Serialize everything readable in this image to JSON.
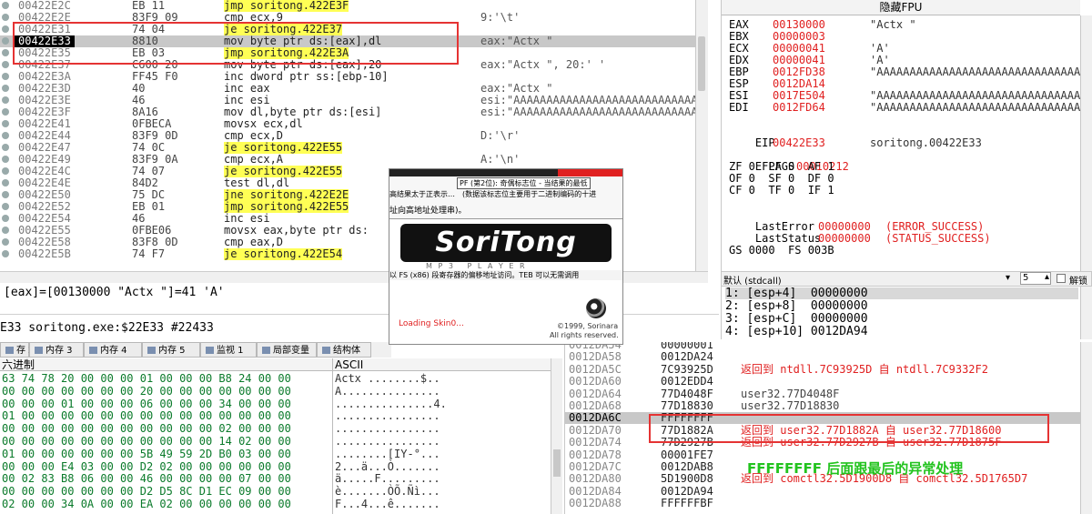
{
  "disasm": {
    "rows": [
      {
        "addr": "00422E2C",
        "hex": "EB 11",
        "asm": "jmp soritong.422E3F",
        "cmt": "",
        "hl": "y"
      },
      {
        "addr": "00422E2E",
        "hex": "83F9 09",
        "asm": "cmp ecx,9",
        "cmt": "9:'\\t'",
        "hl": ""
      },
      {
        "addr": "00422E31",
        "hex": "74 04",
        "asm": "je soritong.422E37",
        "cmt": "",
        "hl": "y"
      },
      {
        "addr": "00422E33",
        "hex": "8810",
        "asm": "mov byte ptr ds:[eax],dl",
        "cmt": "eax:\"Actx \"",
        "hl": "sel"
      },
      {
        "addr": "00422E35",
        "hex": "EB 03",
        "asm": "jmp soritong.422E3A",
        "cmt": "",
        "hl": "y"
      },
      {
        "addr": "00422E37",
        "hex": "C600 20",
        "asm": "mov byte ptr ds:[eax],20",
        "cmt": "eax:\"Actx \", 20:' '",
        "hl": ""
      },
      {
        "addr": "00422E3A",
        "hex": "FF45 F0",
        "asm": "inc dword ptr ss:[ebp-10]",
        "cmt": "",
        "hl": ""
      },
      {
        "addr": "00422E3D",
        "hex": "40",
        "asm": "inc eax",
        "cmt": "eax:\"Actx \"",
        "hl": ""
      },
      {
        "addr": "00422E3E",
        "hex": "46",
        "asm": "inc esi",
        "cmt": "esi:\"AAAAAAAAAAAAAAAAAAAAAAAAAAAAAAAAAAAAA",
        "hl": ""
      },
      {
        "addr": "00422E3F",
        "hex": "8A16",
        "asm": "mov dl,byte ptr ds:[esi]",
        "cmt": "esi:\"AAAAAAAAAAAAAAAAAAAAAAAAAAAAAAAAAAAAA",
        "hl": ""
      },
      {
        "addr": "00422E41",
        "hex": "0FBECA",
        "asm": "movsx ecx,dl",
        "cmt": "",
        "hl": ""
      },
      {
        "addr": "00422E44",
        "hex": "83F9 0D",
        "asm": "cmp ecx,D",
        "cmt": "D:'\\r'",
        "hl": ""
      },
      {
        "addr": "00422E47",
        "hex": "74 0C",
        "asm": "je soritong.422E55",
        "cmt": "",
        "hl": "y"
      },
      {
        "addr": "00422E49",
        "hex": "83F9 0A",
        "asm": "cmp ecx,A",
        "cmt": "A:'\\n'",
        "hl": ""
      },
      {
        "addr": "00422E4C",
        "hex": "74 07",
        "asm": "je soritong.422E55",
        "cmt": "",
        "hl": "y"
      },
      {
        "addr": "00422E4E",
        "hex": "84D2",
        "asm": "test dl,dl",
        "cmt": "",
        "hl": ""
      },
      {
        "addr": "00422E50",
        "hex": "75 DC",
        "asm": "jne soritong.422E2E",
        "cmt": "",
        "hl": "y"
      },
      {
        "addr": "00422E52",
        "hex": "EB 01",
        "asm": "jmp soritong.422E55",
        "cmt": "",
        "hl": "y"
      },
      {
        "addr": "00422E54",
        "hex": "46",
        "asm": "inc esi",
        "cmt": "",
        "hl": ""
      },
      {
        "addr": "00422E55",
        "hex": "0FBE06",
        "asm": "movsx eax,byte ptr ds:",
        "cmt": "",
        "hl": ""
      },
      {
        "addr": "00422E58",
        "hex": "83F8 0D",
        "asm": "cmp eax,D",
        "cmt": "",
        "hl": ""
      },
      {
        "addr": "00422E5B",
        "hex": "74 F7",
        "asm": "je soritong.422E54",
        "cmt": "",
        "hl": "y"
      }
    ]
  },
  "info_line": "[eax]=[00130000 \"Actx \"]=41 'A'",
  "status_line": "E33 soritong.exe:$22E33 #22433",
  "registers": {
    "header": "隐藏FPU",
    "rows": [
      {
        "n": "EAX",
        "v": "00130000",
        "c": "\"Actx \""
      },
      {
        "n": "EBX",
        "v": "00000003",
        "c": ""
      },
      {
        "n": "ECX",
        "v": "00000041",
        "c": "'A'"
      },
      {
        "n": "EDX",
        "v": "00000041",
        "c": "'A'"
      },
      {
        "n": "EBP",
        "v": "0012FD38",
        "c": "\"AAAAAAAAAAAAAAAAAAAAAAAAAAAAAAAAAAAA"
      },
      {
        "n": "ESP",
        "v": "0012DA14",
        "c": ""
      },
      {
        "n": "ESI",
        "v": "0017E504",
        "c": "\"AAAAAAAAAAAAAAAAAAAAAAAAAAAAAAAAAAAA"
      },
      {
        "n": "EDI",
        "v": "0012FD64",
        "c": "\"AAAAAAAAAAAAAAAAAAAAAAAAAAAAAAAAAAAA"
      }
    ],
    "eip": {
      "n": "EIP",
      "v": "00422E33",
      "c": "soritong.00422E33"
    },
    "eflags": {
      "n": "EFLAGS",
      "v": "00010212"
    },
    "flags_lines": [
      "ZF 0  PF 0  AF 1",
      "OF 0  SF 0  DF 0",
      "CF 0  TF 0  IF 1"
    ],
    "last_error": {
      "n": "LastError",
      "v": "00000000",
      "c": "(ERROR_SUCCESS)"
    },
    "last_status": {
      "n": "LastStatus",
      "v": "00000000",
      "c": "(STATUS_SUCCESS)"
    },
    "seg_line": "GS 0000  FS 003B"
  },
  "callconv": {
    "select": "默认 (stdcall)",
    "num": "5",
    "unlock": "解锁"
  },
  "stack_args": [
    "1: [esp+4]  00000000",
    "2: [esp+8]  00000000",
    "3: [esp+C]  00000000",
    "4: [esp+10] 0012DA94"
  ],
  "tabs": [
    {
      "label": "存 2",
      "icon": "memory-icon"
    },
    {
      "label": "内存 3",
      "icon": "memory-icon"
    },
    {
      "label": "内存 4",
      "icon": "memory-icon"
    },
    {
      "label": "内存 5",
      "icon": "memory-icon"
    },
    {
      "label": "监视 1",
      "icon": "watch-icon"
    },
    {
      "label": "局部变量",
      "icon": "locals-icon"
    },
    {
      "label": "结构体",
      "icon": "struct-icon"
    }
  ],
  "dump": {
    "header_hex": "六进制",
    "header_ascii": "ASCII",
    "rows": [
      {
        "hex": "63 74 78 20 00 00 00 01 00 00 00 B8 24 00 00",
        "ascii": "Actx ........$.."
      },
      {
        "hex": "00 00 00 00 00 00 00 20 00 00 00 00 00 00 00",
        "ascii": "A..............."
      },
      {
        "hex": "00 00 00 01 00 00 00 06 00 00 00 34 00 00 00",
        "ascii": "...............4."
      },
      {
        "hex": "01 00 00 00 00 00 00 00 00 00 00 00 00 00 00",
        "ascii": "................"
      },
      {
        "hex": "00 00 00 00 00 00 00 00 00 00 00 02 00 00 00",
        "ascii": "................"
      },
      {
        "hex": "00 00 00 00 00 00 00 00 00 00 00 14 02 00 00",
        "ascii": "................"
      },
      {
        "hex": "01 00 00 00 00 00 00 5B 49 59 2D B0 03 00 00",
        "ascii": "........[IY-°..."
      },
      {
        "hex": "00 00 00 E4 03 00 00 D2 02 00 00 00 00 00 00",
        "ascii": "2...ä...Ò......."
      },
      {
        "hex": "00 02 83 B8 06 00 00 46 00 00 00 00 07 00 00",
        "ascii": "ä.....F........."
      },
      {
        "hex": "00 00 00 00 00 00 00 D2 D5 8C D1 EC 09 00 00",
        "ascii": "è.......ÒÕ.Ñì..."
      },
      {
        "hex": "02 00 00 34 0A 00 00 EA 02 00 00 00 00 00 00",
        "ascii": "F...4...ê......."
      }
    ]
  },
  "stack": {
    "rows": [
      {
        "a": "0012DA54",
        "v": "00000001",
        "c": ""
      },
      {
        "a": "0012DA58",
        "v": "0012DA24",
        "c": ""
      },
      {
        "a": "0012DA5C",
        "v": "7C93925D",
        "c": "返回到 ntdll.7C93925D 自 ntdll.7C9332F2"
      },
      {
        "a": "0012DA60",
        "v": "0012EDD4",
        "c": ""
      },
      {
        "a": "0012DA64",
        "v": "77D4048F",
        "c": "user32.77D4048F"
      },
      {
        "a": "0012DA68",
        "v": "77D18830",
        "c": "user32.77D18830"
      },
      {
        "a": "0012DA6C",
        "v": "FFFFFFFF",
        "c": ""
      },
      {
        "a": "0012DA70",
        "v": "77D1882A",
        "c": "返回到 user32.77D1882A 自 user32.77D18600"
      },
      {
        "a": "0012DA74",
        "v": "77D2927B",
        "c": "返回到 user32.77D2927B 自 user32.77D1875F"
      },
      {
        "a": "0012DA78",
        "v": "00001FE7",
        "c": ""
      },
      {
        "a": "0012DA7C",
        "v": "0012DAB8",
        "c": ""
      },
      {
        "a": "0012DA80",
        "v": "5D1900D8",
        "c": "返回到 comctl32.5D1900D8 自 comctl32.5D1765D7"
      },
      {
        "a": "0012DA84",
        "v": "0012DA94",
        "c": ""
      },
      {
        "a": "0012DA88",
        "v": "FFFFFFBF",
        "c": ""
      }
    ],
    "annotation": "FFFFFFFF 后面跟最后的异常处理"
  },
  "splash": {
    "tooltip_title": "PF (第2位): 奇偶标志位 - 当结果的最低",
    "tooltip_lines": [
      "高结果太于正表示…",
      "(数据该标志位主要用于二进制编码的十进",
      "址向高地址处理串)。"
    ],
    "bottom_tip": "以 FS (x86) 段寄存器的偏移地址访问。TEB 可以无需调用",
    "logo": "SoriTong",
    "subtitle": "M P 3   P L A Y E R",
    "loading": "Loading Skin0...",
    "copyright1": "©1999, Sorinara",
    "copyright2": "All rights reserved."
  }
}
